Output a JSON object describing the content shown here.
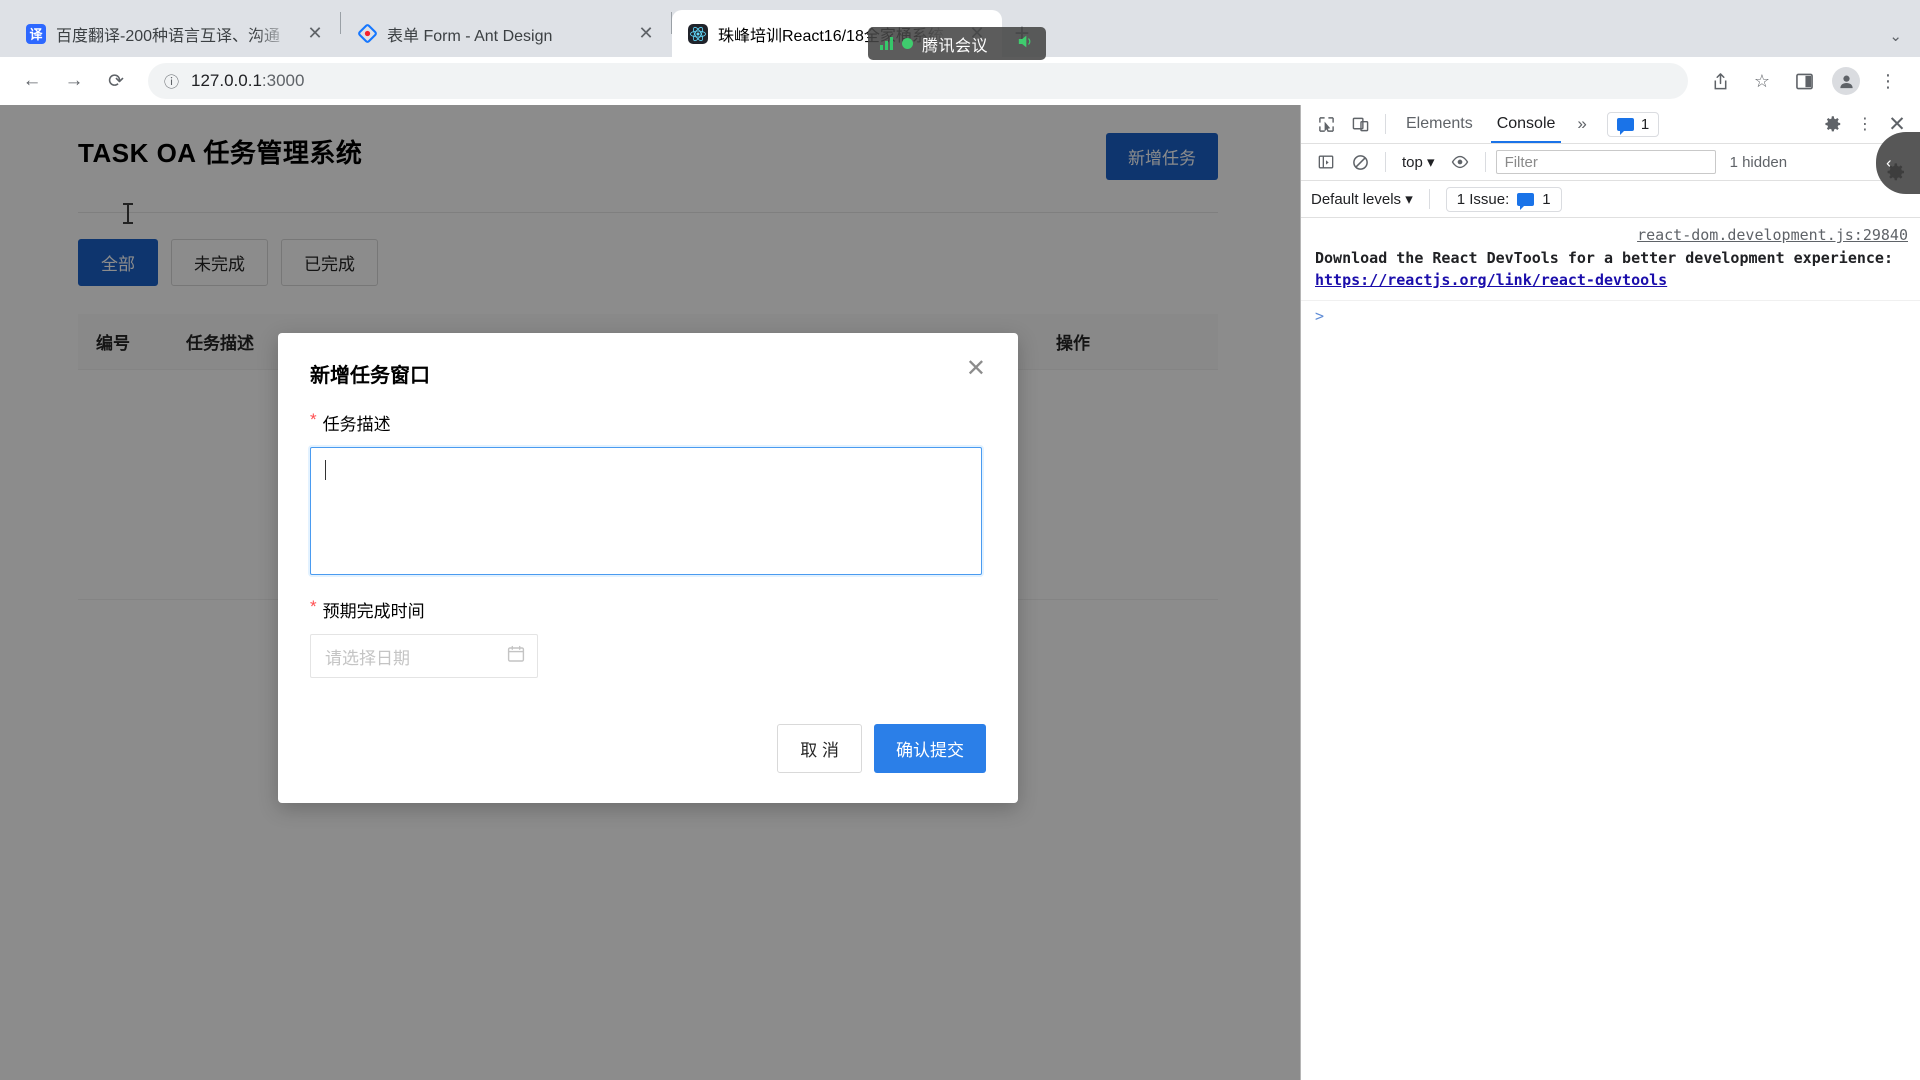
{
  "browser": {
    "tabs": [
      {
        "title": "百度翻译-200种语言互译、沟通",
        "favicon": "baidu-translate-icon",
        "favicon_text": "译",
        "active": false,
        "close_label": "✕"
      },
      {
        "title": "表单 Form - Ant Design",
        "favicon": "ant-design-icon",
        "favicon_text": "",
        "active": false,
        "close_label": "✕"
      },
      {
        "title": "珠峰培训React16/18全家桶系统",
        "favicon": "react-icon",
        "favicon_text": "",
        "active": true,
        "close_label": "✕"
      }
    ],
    "new_tab_label": "+",
    "tabstrip_menu": "⌄",
    "nav": {
      "back": "←",
      "forward": "→",
      "reload": "⟳"
    },
    "omnibox": {
      "info_icon": "ⓘ",
      "host": "127.0.0.1",
      "port": ":3000"
    },
    "actions": {
      "share": "⇧",
      "bookmark": "☆",
      "sidepanel": "▣",
      "profile": "●",
      "menu": "⋮"
    }
  },
  "meeting_overlay": {
    "label": "腾讯会议",
    "signal_icon": "signal-bars-icon",
    "status_icon": "green-dot-icon",
    "speaker_icon": "speaker-icon",
    "speaker_glyph": "🔊"
  },
  "page": {
    "title": "TASK OA 任务管理系统",
    "add_task_button": "新增任务",
    "filters": [
      {
        "label": "全部",
        "selected": true
      },
      {
        "label": "未完成",
        "selected": false
      },
      {
        "label": "已完成",
        "selected": false
      }
    ],
    "table": {
      "columns": [
        "编号",
        "任务描述",
        "操作"
      ]
    }
  },
  "modal": {
    "title": "新增任务窗口",
    "close_label": "✕",
    "fields": {
      "description": {
        "required_mark": "*",
        "label": "任务描述",
        "value": "",
        "focused": true
      },
      "due_date": {
        "required_mark": "*",
        "label": "预期完成时间",
        "placeholder": "请选择日期",
        "value": "",
        "calendar_icon": "calendar-icon"
      }
    },
    "cancel_button": "取 消",
    "submit_button": "确认提交"
  },
  "devtools": {
    "toolbar": {
      "inspect_icon": "inspect-element-icon",
      "device_icon": "device-toolbar-icon",
      "tabs": [
        {
          "label": "Elements",
          "active": false
        },
        {
          "label": "Console",
          "active": true
        }
      ],
      "more_tabs": "»",
      "issues_count": "1",
      "settings_icon": "gear-icon",
      "kebab_icon": "⋮",
      "close_icon": "✕"
    },
    "filterbar": {
      "sidebar_icon": "console-sidebar-icon",
      "clear_icon": "⊘",
      "context": "top",
      "context_caret": "▾",
      "eye_icon": "eye-icon",
      "filter_placeholder": "Filter",
      "hidden_label": "1 hidden"
    },
    "levelbar": {
      "levels": "Default levels",
      "levels_caret": "▾",
      "issue_label": "1 Issue:",
      "issue_count": "1"
    },
    "console": {
      "source": "react-dom.development.js:29840",
      "message_part1": "Download the React DevTools for a better development experience: ",
      "message_link": "https://reactjs.org/link/react-devtools",
      "prompt": ">"
    },
    "collapse_chevron": "‹"
  },
  "colors": {
    "accent_blue": "#1a62c9",
    "submit_blue": "#2b7fe8",
    "devtools_link": "#1a0dab",
    "required_red": "#ff4d4f",
    "meeting_green": "#3fcc6e",
    "tabstrip_bg": "#dee1e6"
  }
}
